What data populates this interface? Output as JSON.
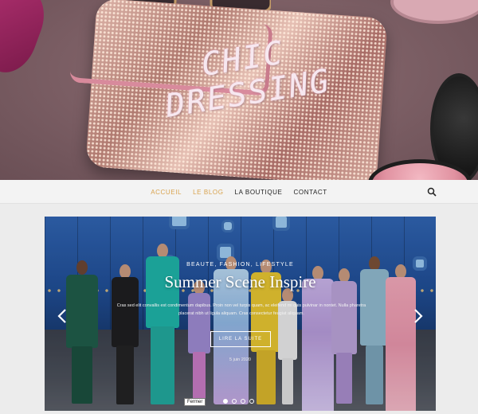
{
  "header": {
    "site_title": "CHIC DRESSING"
  },
  "nav": {
    "items": [
      {
        "label": "ACCUEIL",
        "active": true
      },
      {
        "label": "LE BLOG",
        "active": true
      },
      {
        "label": "LA BOUTIQUE",
        "active": false
      },
      {
        "label": "CONTACT",
        "active": false
      }
    ],
    "search_icon": "search-icon",
    "accent_color": "#d9a34e"
  },
  "slider": {
    "category": "BEAUTE, FASHION, LIFESTYLE",
    "title": "Summer Scene Inspire",
    "excerpt": "Cras sed elit convallis est condimentum dapibus. Proin non vel turpis quam, ac eleifend mi quis pulvinar in nontet. Nulla pharetra placerat nibh ut ligula aliquam. Cras consectetur feugiat aliquam.",
    "button_label": "LIRE LA SUITE",
    "date": "5 juin 2020",
    "prev_icon": "chevron-left-icon",
    "next_icon": "chevron-right-icon",
    "dots": [
      true,
      false,
      false,
      false
    ],
    "tooltip": "Fermer"
  }
}
